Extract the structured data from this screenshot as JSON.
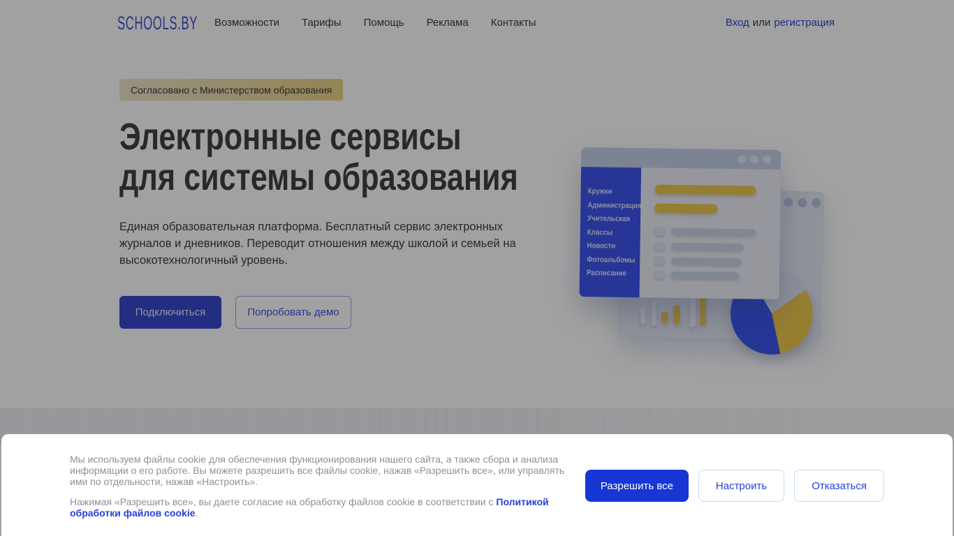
{
  "header": {
    "logo": "SCHOOLS.BY",
    "nav": [
      "Возможности",
      "Тарифы",
      "Помощь",
      "Реклама",
      "Контакты"
    ],
    "auth": {
      "login": "Вход",
      "or": "или",
      "register": "регистрация"
    }
  },
  "hero": {
    "badge": "Согласовано с Министерством образования",
    "title_line1": "Электронные сервисы",
    "title_line2": "для системы образования",
    "description": "Единая образовательная платформа. Бесплатный сервис электронных журналов и дневников. Переводит отношения между школой и семьей на высокотехнологичный уровень.",
    "primary_button": "Подключиться",
    "secondary_button": "Попробовать демо"
  },
  "illustration": {
    "menu_items": [
      "Кружки",
      "Администрация",
      "Учительская",
      "Классы",
      "Новости",
      "Фотоальбомы",
      "Расписание"
    ]
  },
  "cookie_banner": {
    "paragraph1": "Мы используем файлы cookie для обеспечения функционирования нашего сайта, а также сбора и анализа информации о его работе. Вы можете разрешить все файлы cookie, нажав «Разрешить все», или управлять ими по отдельности, нажав «Настроить».",
    "paragraph2_prefix": "Нажимая «Разрешить все», вы даете согласие на обработку файлов cookie в соответствии с ",
    "paragraph2_link": "Политикой обработки файлов cookie",
    "paragraph2_suffix": ".",
    "buttons": {
      "allow": "Разрешить все",
      "configure": "Настроить",
      "decline": "Отказаться"
    }
  },
  "colors": {
    "brand_blue": "#1736d4",
    "link_blue": "#2440d9",
    "hero_button_blue": "#3649cf",
    "badge_gold": "#ecd387",
    "illustration_sidebar_blue": "#3d55ee",
    "illustration_yellow": "#eec84f",
    "text_dark": "#3c3c3c",
    "cookie_text_gray": "#8e9097"
  }
}
